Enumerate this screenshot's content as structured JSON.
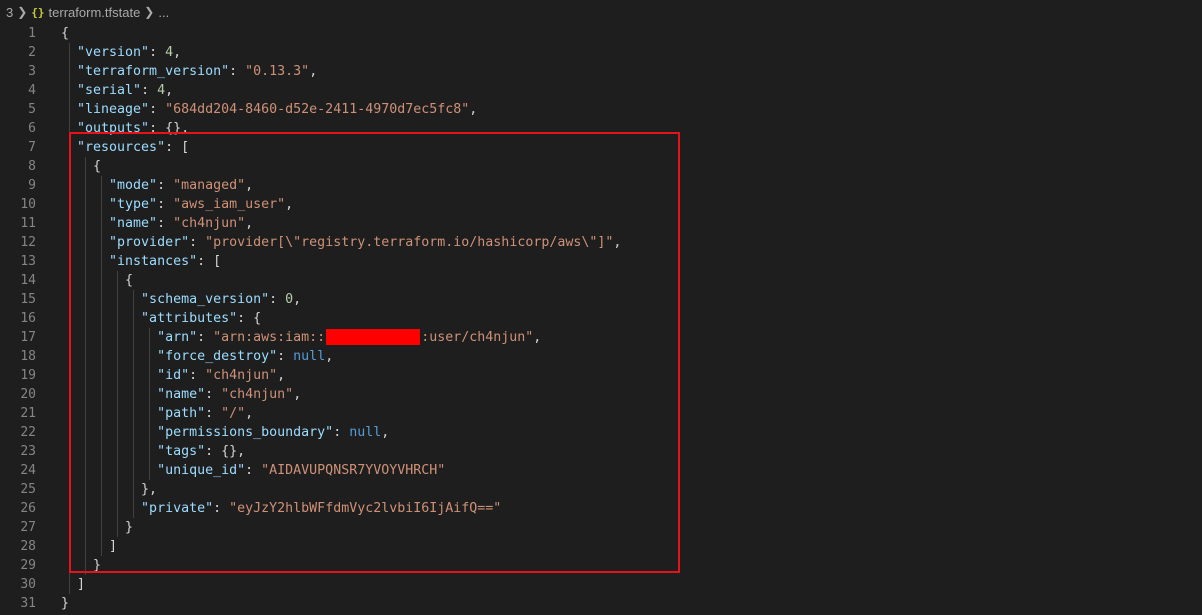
{
  "breadcrumb": {
    "prefix": "3",
    "file_icon": "{}",
    "file_name": "terraform.tfstate",
    "ellipsis": "..."
  },
  "lines": [
    {
      "n": "1",
      "html": [
        {
          "t": "p",
          "v": "{"
        }
      ]
    },
    {
      "n": "2",
      "html": [
        {
          "t": "k",
          "v": "  \"version\""
        },
        {
          "t": "p",
          "v": ": "
        },
        {
          "t": "n",
          "v": "4"
        },
        {
          "t": "p",
          "v": ","
        }
      ]
    },
    {
      "n": "3",
      "html": [
        {
          "t": "k",
          "v": "  \"terraform_version\""
        },
        {
          "t": "p",
          "v": ": "
        },
        {
          "t": "s",
          "v": "\"0.13.3\""
        },
        {
          "t": "p",
          "v": ","
        }
      ]
    },
    {
      "n": "4",
      "html": [
        {
          "t": "k",
          "v": "  \"serial\""
        },
        {
          "t": "p",
          "v": ": "
        },
        {
          "t": "n",
          "v": "4"
        },
        {
          "t": "p",
          "v": ","
        }
      ]
    },
    {
      "n": "5",
      "html": [
        {
          "t": "k",
          "v": "  \"lineage\""
        },
        {
          "t": "p",
          "v": ": "
        },
        {
          "t": "s",
          "v": "\"684dd204-8460-d52e-2411-4970d7ec5fc8\""
        },
        {
          "t": "p",
          "v": ","
        }
      ]
    },
    {
      "n": "6",
      "html": [
        {
          "t": "k",
          "v": "  \"outputs\""
        },
        {
          "t": "p",
          "v": ": {},"
        }
      ]
    },
    {
      "n": "7",
      "html": [
        {
          "t": "k",
          "v": "  \"resources\""
        },
        {
          "t": "p",
          "v": ": ["
        }
      ]
    },
    {
      "n": "8",
      "html": [
        {
          "t": "p",
          "v": "    {"
        }
      ]
    },
    {
      "n": "9",
      "html": [
        {
          "t": "k",
          "v": "      \"mode\""
        },
        {
          "t": "p",
          "v": ": "
        },
        {
          "t": "s",
          "v": "\"managed\""
        },
        {
          "t": "p",
          "v": ","
        }
      ]
    },
    {
      "n": "10",
      "html": [
        {
          "t": "k",
          "v": "      \"type\""
        },
        {
          "t": "p",
          "v": ": "
        },
        {
          "t": "s",
          "v": "\"aws_iam_user\""
        },
        {
          "t": "p",
          "v": ","
        }
      ]
    },
    {
      "n": "11",
      "html": [
        {
          "t": "k",
          "v": "      \"name\""
        },
        {
          "t": "p",
          "v": ": "
        },
        {
          "t": "s",
          "v": "\"ch4njun\""
        },
        {
          "t": "p",
          "v": ","
        }
      ]
    },
    {
      "n": "12",
      "html": [
        {
          "t": "k",
          "v": "      \"provider\""
        },
        {
          "t": "p",
          "v": ": "
        },
        {
          "t": "s",
          "v": "\"provider[\\\"registry.terraform.io/hashicorp/aws\\\"]\""
        },
        {
          "t": "p",
          "v": ","
        }
      ]
    },
    {
      "n": "13",
      "html": [
        {
          "t": "k",
          "v": "      \"instances\""
        },
        {
          "t": "p",
          "v": ": ["
        }
      ]
    },
    {
      "n": "14",
      "html": [
        {
          "t": "p",
          "v": "        {"
        }
      ]
    },
    {
      "n": "15",
      "html": [
        {
          "t": "k",
          "v": "          \"schema_version\""
        },
        {
          "t": "p",
          "v": ": "
        },
        {
          "t": "n",
          "v": "0"
        },
        {
          "t": "p",
          "v": ","
        }
      ]
    },
    {
      "n": "16",
      "html": [
        {
          "t": "k",
          "v": "          \"attributes\""
        },
        {
          "t": "p",
          "v": ": {"
        }
      ]
    },
    {
      "n": "17",
      "html": [
        {
          "t": "k",
          "v": "            \"arn\""
        },
        {
          "t": "p",
          "v": ": "
        },
        {
          "t": "s",
          "v": "\"arn:aws:iam::"
        },
        {
          "t": "redact",
          "v": ""
        },
        {
          "t": "s",
          "v": ":user/ch4njun\""
        },
        {
          "t": "p",
          "v": ","
        }
      ]
    },
    {
      "n": "18",
      "html": [
        {
          "t": "k",
          "v": "            \"force_destroy\""
        },
        {
          "t": "p",
          "v": ": "
        },
        {
          "t": "c",
          "v": "null"
        },
        {
          "t": "p",
          "v": ","
        }
      ]
    },
    {
      "n": "19",
      "html": [
        {
          "t": "k",
          "v": "            \"id\""
        },
        {
          "t": "p",
          "v": ": "
        },
        {
          "t": "s",
          "v": "\"ch4njun\""
        },
        {
          "t": "p",
          "v": ","
        }
      ]
    },
    {
      "n": "20",
      "html": [
        {
          "t": "k",
          "v": "            \"name\""
        },
        {
          "t": "p",
          "v": ": "
        },
        {
          "t": "s",
          "v": "\"ch4njun\""
        },
        {
          "t": "p",
          "v": ","
        }
      ]
    },
    {
      "n": "21",
      "html": [
        {
          "t": "k",
          "v": "            \"path\""
        },
        {
          "t": "p",
          "v": ": "
        },
        {
          "t": "s",
          "v": "\"/\""
        },
        {
          "t": "p",
          "v": ","
        }
      ]
    },
    {
      "n": "22",
      "html": [
        {
          "t": "k",
          "v": "            \"permissions_boundary\""
        },
        {
          "t": "p",
          "v": ": "
        },
        {
          "t": "c",
          "v": "null"
        },
        {
          "t": "p",
          "v": ","
        }
      ]
    },
    {
      "n": "23",
      "html": [
        {
          "t": "k",
          "v": "            \"tags\""
        },
        {
          "t": "p",
          "v": ": {},"
        }
      ]
    },
    {
      "n": "24",
      "html": [
        {
          "t": "k",
          "v": "            \"unique_id\""
        },
        {
          "t": "p",
          "v": ": "
        },
        {
          "t": "s",
          "v": "\"AIDAVUPQNSR7YVOYVHRCH\""
        }
      ]
    },
    {
      "n": "25",
      "html": [
        {
          "t": "p",
          "v": "          },"
        }
      ]
    },
    {
      "n": "26",
      "html": [
        {
          "t": "k",
          "v": "          \"private\""
        },
        {
          "t": "p",
          "v": ": "
        },
        {
          "t": "s",
          "v": "\"eyJzY2hlbWFfdmVyc2lvbiI6IjAifQ==\""
        }
      ]
    },
    {
      "n": "27",
      "html": [
        {
          "t": "p",
          "v": "        }"
        }
      ]
    },
    {
      "n": "28",
      "html": [
        {
          "t": "p",
          "v": "      ]"
        }
      ]
    },
    {
      "n": "29",
      "html": [
        {
          "t": "p",
          "v": "    }"
        }
      ]
    },
    {
      "n": "30",
      "html": [
        {
          "t": "p",
          "v": "  ]"
        }
      ]
    },
    {
      "n": "31",
      "html": [
        {
          "t": "p",
          "v": "}"
        }
      ]
    }
  ],
  "colors": {
    "background": "#1e1e1e",
    "key": "#9cdcfe",
    "string": "#ce9178",
    "number": "#b5cea8",
    "constant": "#569cd6",
    "highlight_box": "#e8131a",
    "redaction": "#ff0000"
  }
}
